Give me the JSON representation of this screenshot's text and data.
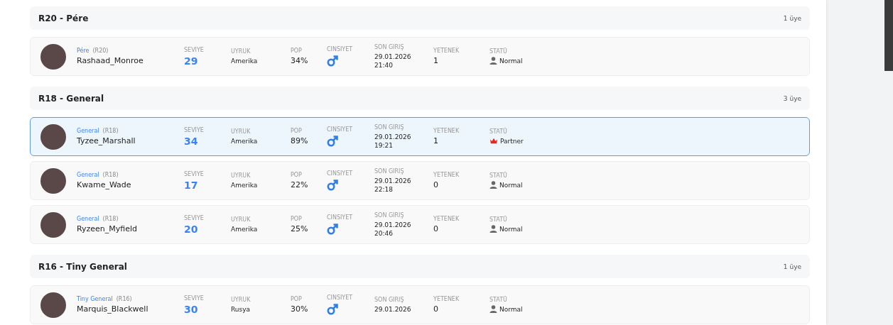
{
  "groups": [
    {
      "title": "R20 - Pére",
      "count": "1 üye",
      "members": [
        {
          "rank": "Pére",
          "rank_code": "(R20)",
          "name": "Rashaad_Monroe",
          "level_label": "SEVIYE",
          "level_value": "29",
          "nation_label": "UYRUK",
          "nation": "Amerika",
          "pop_label": "POP",
          "pop": "34%",
          "gender_label": "CINSIYET",
          "last_label": "SON GIRIŞ",
          "last_date": "29.01.2026",
          "last_time": "21:40",
          "skill_label": "YETENEK",
          "skill": "1",
          "status_label": "STATÜ",
          "kind": "normal",
          "status": "Normal",
          "selected": false
        }
      ]
    },
    {
      "title": "R18 - General",
      "count": "3 üye",
      "members": [
        {
          "rank": "General",
          "rank_code": "(R18)",
          "name": "Tyzee_Marshall",
          "level_label": "SEVIYE",
          "level_value": "34",
          "nation_label": "UYRUK",
          "nation": "Amerika",
          "pop_label": "POP",
          "pop": "89%",
          "gender_label": "CINSIYET",
          "last_label": "SON GIRIŞ",
          "last_date": "29.01.2026",
          "last_time": "19:21",
          "skill_label": "YETENEK",
          "skill": "1",
          "status_label": "STATÜ",
          "kind": "partner",
          "status": "Partner",
          "selected": true
        },
        {
          "rank": "General",
          "rank_code": "(R18)",
          "name": "Kwame_Wade",
          "level_label": "SEVIYE",
          "level_value": "17",
          "nation_label": "UYRUK",
          "nation": "Amerika",
          "pop_label": "POP",
          "pop": "22%",
          "gender_label": "CINSIYET",
          "last_label": "SON GIRIŞ",
          "last_date": "29.01.2026",
          "last_time": "22:18",
          "skill_label": "YETENEK",
          "skill": "0",
          "status_label": "STATÜ",
          "kind": "normal",
          "status": "Normal",
          "selected": false
        },
        {
          "rank": "General",
          "rank_code": "(R18)",
          "name": "Ryzeen_Myfield",
          "level_label": "SEVIYE",
          "level_value": "20",
          "nation_label": "UYRUK",
          "nation": "Amerika",
          "pop_label": "POP",
          "pop": "25%",
          "gender_label": "CINSIYET",
          "last_label": "SON GIRIŞ",
          "last_date": "29.01.2026",
          "last_time": "20:46",
          "skill_label": "YETENEK",
          "skill": "0",
          "status_label": "STATÜ",
          "kind": "normal",
          "status": "Normal",
          "selected": false
        }
      ]
    },
    {
      "title": "R16 - Tiny General",
      "count": "1 üye",
      "members": [
        {
          "rank": "Tiny General",
          "rank_code": "(R16)",
          "name": "Marquis_Blackwell",
          "level_label": "SEVIYE",
          "level_value": "30",
          "nation_label": "UYRUK",
          "nation": "Rusya",
          "pop_label": "POP",
          "pop": "30%",
          "gender_label": "CINSIYET",
          "last_label": "SON GIRIŞ",
          "last_date": "29.01.2026",
          "skill_label": "YETENEK",
          "skill": "0",
          "status_label": "STATÜ",
          "kind": "normal",
          "status": "Normal",
          "selected": false
        }
      ]
    }
  ]
}
